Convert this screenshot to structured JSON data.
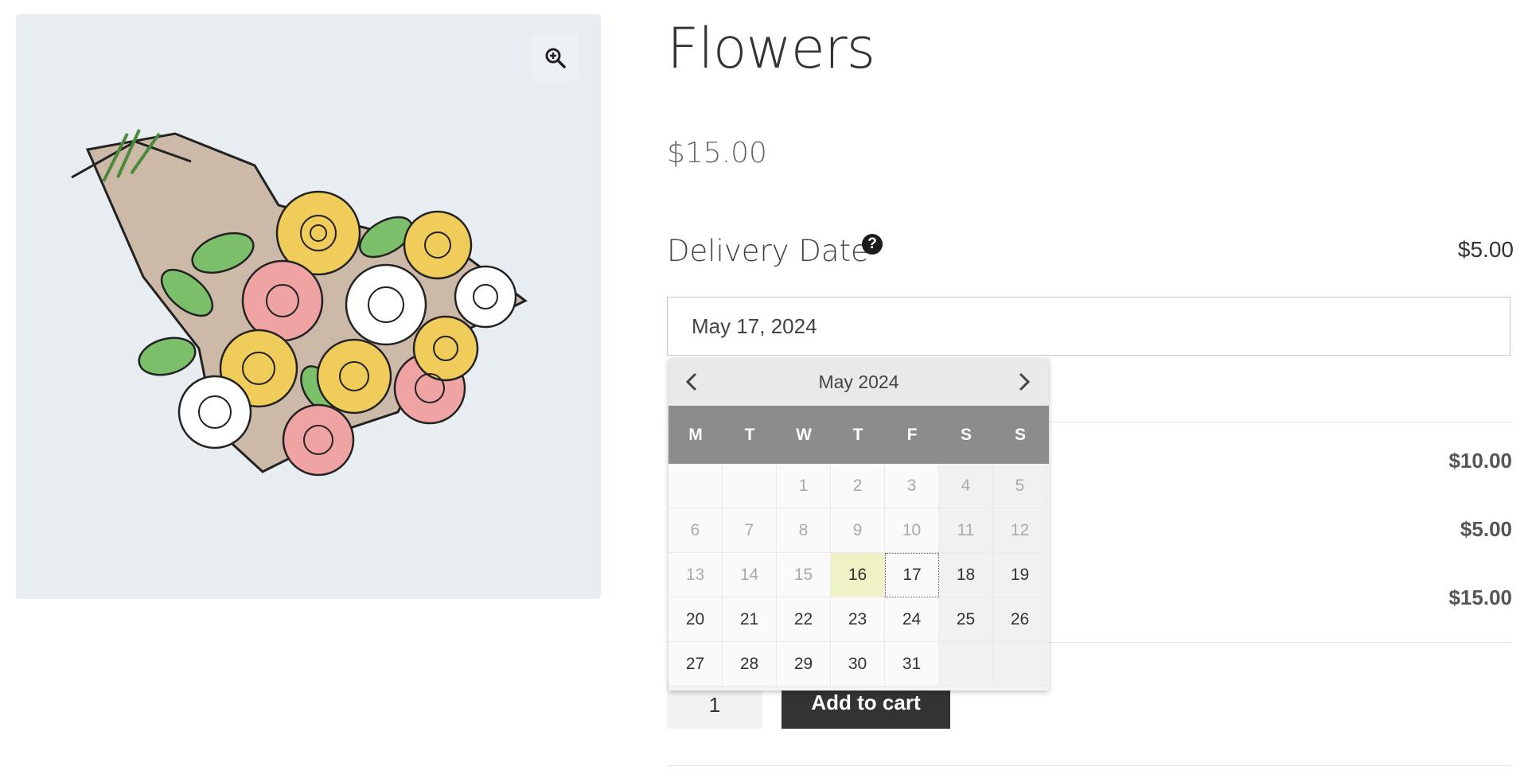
{
  "product": {
    "title": "Flowers",
    "price": "$15.00",
    "image_label": "bouquet-of-roses"
  },
  "delivery": {
    "label": "Delivery Date",
    "required_mark": "*",
    "help_glyph": "?",
    "price": "$5.00",
    "value": "May 17, 2024"
  },
  "datepicker": {
    "month_label": "May 2024",
    "prev_glyph": "‹",
    "next_glyph": "›",
    "weekdays": [
      "M",
      "T",
      "W",
      "T",
      "F",
      "S",
      "S"
    ],
    "leading_blank_days": 2,
    "days_in_month": 31,
    "last_disabled_day": 15,
    "today": 16,
    "selected": 17
  },
  "summary": {
    "rows": [
      "$10.00",
      "$5.00",
      "$15.00"
    ]
  },
  "cart": {
    "quantity": "1",
    "add_to_cart_label": "Add to cart"
  },
  "colors": {
    "today_highlight": "#eef2c4",
    "weekday_header": "#8c8c8c",
    "button_bg": "#333333",
    "required": "#c40000"
  }
}
